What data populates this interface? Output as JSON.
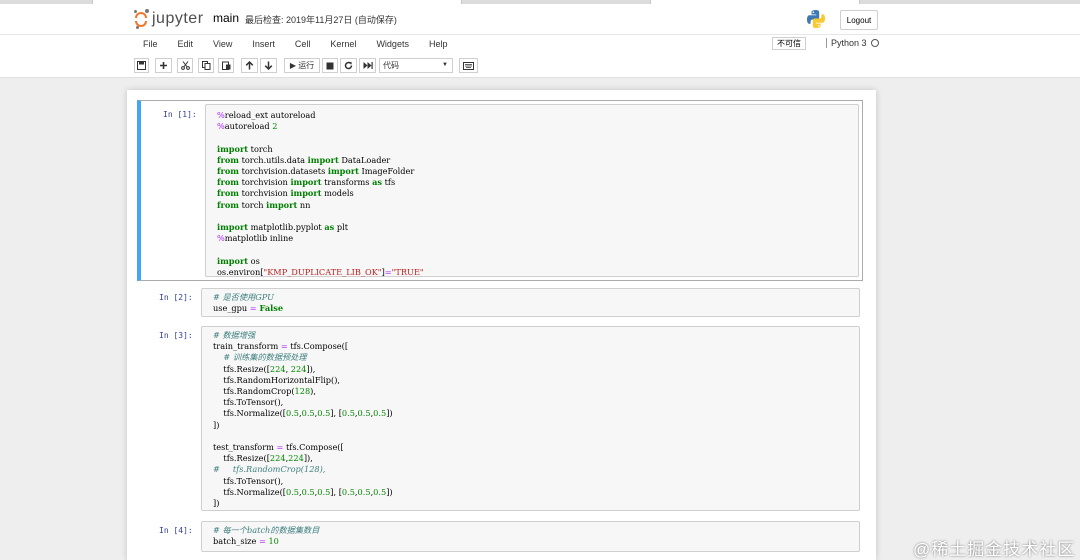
{
  "header": {
    "logo_text": "jupyter",
    "notebook_name": "main",
    "checkpoint": "最后检查: 2019年11月27日  (自动保存)",
    "logout_label": "Logout"
  },
  "menu": {
    "items": [
      "File",
      "Edit",
      "View",
      "Insert",
      "Cell",
      "Kernel",
      "Widgets",
      "Help"
    ],
    "trusted_label": "不可信",
    "kernel_name": "Python 3"
  },
  "toolbar": {
    "run_label": "▶ 运行",
    "cell_type_value": "代码"
  },
  "cells": [
    {
      "prompt": "In  [1]:",
      "lines": [
        [
          [
            "magic",
            "%"
          ],
          [
            "",
            "reload_ext autoreload"
          ]
        ],
        [
          [
            "magic",
            "%"
          ],
          [
            "",
            "autoreload "
          ],
          [
            "num",
            "2"
          ]
        ],
        [],
        [
          [
            "kw",
            "import"
          ],
          [
            "",
            " torch"
          ]
        ],
        [
          [
            "kw",
            "from"
          ],
          [
            "",
            " torch.utils.data "
          ],
          [
            "kw",
            "import"
          ],
          [
            "",
            " DataLoader"
          ]
        ],
        [
          [
            "kw",
            "from"
          ],
          [
            "",
            " torchvision.datasets "
          ],
          [
            "kw",
            "import"
          ],
          [
            "",
            " ImageFolder"
          ]
        ],
        [
          [
            "kw",
            "from"
          ],
          [
            "",
            " torchvision "
          ],
          [
            "kw",
            "import"
          ],
          [
            "",
            " transforms "
          ],
          [
            "kw",
            "as"
          ],
          [
            "",
            " tfs"
          ]
        ],
        [
          [
            "kw",
            "from"
          ],
          [
            "",
            " torchvision "
          ],
          [
            "kw",
            "import"
          ],
          [
            "",
            " models"
          ]
        ],
        [
          [
            "kw",
            "from"
          ],
          [
            "",
            " torch "
          ],
          [
            "kw",
            "import"
          ],
          [
            "",
            " nn"
          ]
        ],
        [],
        [
          [
            "kw",
            "import"
          ],
          [
            "",
            " matplotlib.pyplot "
          ],
          [
            "kw",
            "as"
          ],
          [
            "",
            " plt"
          ]
        ],
        [
          [
            "magic",
            "%"
          ],
          [
            "",
            "matplotlib inline"
          ]
        ],
        [],
        [
          [
            "kw",
            "import"
          ],
          [
            "",
            " os"
          ]
        ],
        [
          [
            "",
            "os.environ["
          ],
          [
            "str",
            "\"KMP_DUPLICATE_LIB_OK\""
          ],
          [
            "",
            "]"
          ],
          [
            "op",
            "="
          ],
          [
            "str",
            "\"TRUE\""
          ]
        ]
      ]
    },
    {
      "prompt": "In  [2]:",
      "lines": [
        [
          [
            "cm",
            "# 是否使用GPU"
          ]
        ],
        [
          [
            "",
            "use_gpu "
          ],
          [
            "op",
            "="
          ],
          [
            "",
            ""
          ],
          [
            "kw",
            " False"
          ]
        ]
      ]
    },
    {
      "prompt": "In  [3]:",
      "lines": [
        [
          [
            "cm",
            "# 数据增强"
          ]
        ],
        [
          [
            "",
            "train_transform "
          ],
          [
            "op",
            "="
          ],
          [
            "",
            " tfs.Compose(["
          ]
        ],
        [
          [
            "",
            "    "
          ],
          [
            "cm",
            "# 训练集的数据预处理"
          ]
        ],
        [
          [
            "",
            "    tfs.Resize(["
          ],
          [
            "num",
            "224"
          ],
          [
            "",
            ", "
          ],
          [
            "num",
            "224"
          ],
          [
            "",
            "]),"
          ]
        ],
        [
          [
            "",
            "    tfs.RandomHorizontalFlip(),"
          ]
        ],
        [
          [
            "",
            "    tfs.RandomCrop("
          ],
          [
            "num",
            "128"
          ],
          [
            "",
            "),"
          ]
        ],
        [
          [
            "",
            "    tfs.ToTensor(),"
          ]
        ],
        [
          [
            "",
            "    tfs.Normalize(["
          ],
          [
            "num",
            "0.5"
          ],
          [
            "",
            ","
          ],
          [
            "num",
            "0.5"
          ],
          [
            "",
            ","
          ],
          [
            "num",
            "0.5"
          ],
          [
            "",
            "], ["
          ],
          [
            "num",
            "0.5"
          ],
          [
            "",
            ","
          ],
          [
            "num",
            "0.5"
          ],
          [
            "",
            ","
          ],
          [
            "num",
            "0.5"
          ],
          [
            "",
            "])"
          ]
        ],
        [
          [
            "",
            "])"
          ]
        ],
        [],
        [
          [
            "",
            "test_transform "
          ],
          [
            "op",
            "="
          ],
          [
            "",
            " tfs.Compose(["
          ]
        ],
        [
          [
            "",
            "    tfs.Resize(["
          ],
          [
            "num",
            "224"
          ],
          [
            "",
            ","
          ],
          [
            "num",
            "224"
          ],
          [
            "",
            "]),"
          ]
        ],
        [
          [
            "cm",
            "#     tfs.RandomCrop(128),"
          ]
        ],
        [
          [
            "",
            "    tfs.ToTensor(),"
          ]
        ],
        [
          [
            "",
            "    tfs.Normalize(["
          ],
          [
            "num",
            "0.5"
          ],
          [
            "",
            ","
          ],
          [
            "num",
            "0.5"
          ],
          [
            "",
            ","
          ],
          [
            "num",
            "0.5"
          ],
          [
            "",
            "], ["
          ],
          [
            "num",
            "0.5"
          ],
          [
            "",
            ","
          ],
          [
            "num",
            "0.5"
          ],
          [
            "",
            ","
          ],
          [
            "num",
            "0.5"
          ],
          [
            "",
            "])"
          ]
        ],
        [
          [
            "",
            "])"
          ]
        ]
      ]
    },
    {
      "prompt": "In  [4]:",
      "lines": [
        [
          [
            "cm",
            "# 每一个batch的数据集数目"
          ]
        ],
        [
          [
            "",
            "batch_size "
          ],
          [
            "op",
            "="
          ],
          [
            "",
            " "
          ],
          [
            "num",
            "10"
          ]
        ]
      ]
    }
  ],
  "watermark": "@稀土掘金技术社区"
}
